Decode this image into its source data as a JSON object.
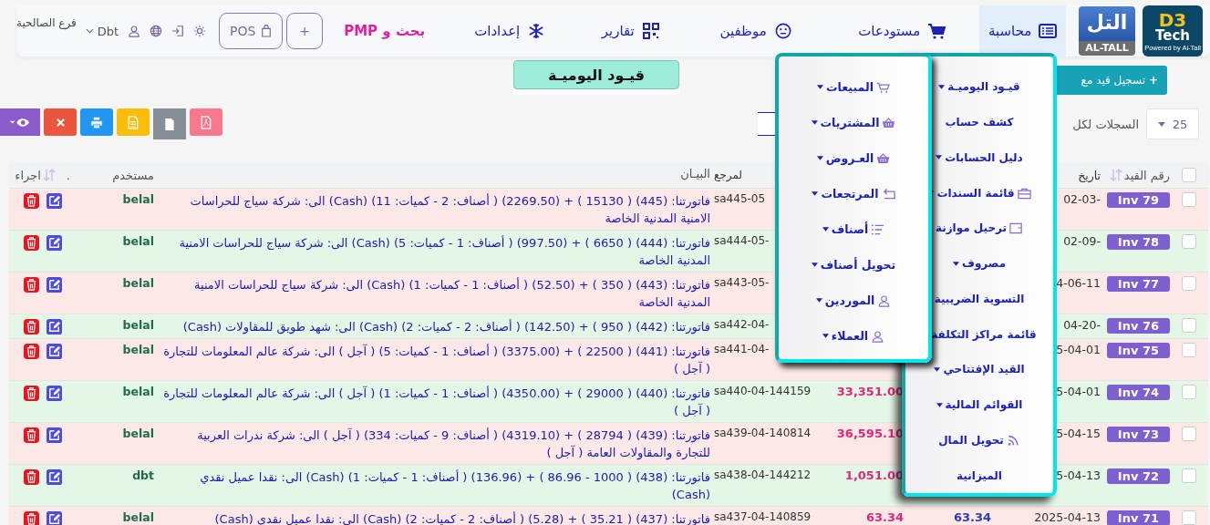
{
  "brand": {
    "logo_main": "D3",
    "logo_sub": "Tech",
    "powered": "Powered by Al-Tall",
    "partner_main": "التل",
    "partner_sub": "AL-TALL"
  },
  "nav": [
    {
      "label": "محاسبة",
      "kind": "table",
      "selected": true
    },
    {
      "label": "مستودعات",
      "kind": "cart",
      "selected": false
    },
    {
      "label": "موظفين",
      "kind": "smile",
      "selected": false
    },
    {
      "label": "تقارير",
      "kind": "qr",
      "selected": false
    },
    {
      "label": "إعدادات",
      "kind": "snow",
      "selected": false
    }
  ],
  "search_link": "بحث و PMP",
  "add_button": "+",
  "pos_button": "POS",
  "user": "Dbt",
  "branch": "فرع الصالحية",
  "page_title": "قيـود اليوميـة",
  "new_entry_button": {
    "icon": "+",
    "label": "تسجيل قيد مع"
  },
  "page_size": {
    "value": "25",
    "label": "السجلات لكل"
  },
  "table": {
    "header": {
      "checked": false,
      "id": "رقم القيد",
      "date": "تاريخ",
      "ref": "لمرجع",
      "desc": "البيـان",
      "user": "مستخدم",
      "dot": ".",
      "actions": "اجراء"
    },
    "rows": [
      {
        "checked": false,
        "id": "Inv 79",
        "date": "-02-03",
        "ref": "sa445-05",
        "desc": "فاتورتنا: (445) ( 15130 ) + (2269.50) ( أصناف: 2 - كميات: 11) (Cash) الى: شركة سياج للحراسات الامنية المدنية الخاصة",
        "user": "belal"
      },
      {
        "checked": false,
        "id": "Inv 78",
        "date": "-02-09",
        "ref": "sa444-05-",
        "desc": "فاتورتنا: (444) ( 6650 ) + (997.50) ( أصناف: 1 - كميات: 5) (Cash) الى: شركة سياج للحراسات الامنية المدنية الخاصة",
        "user": "belal"
      },
      {
        "checked": false,
        "id": "Inv 77",
        "date": "4-06-11",
        "ref": "sa443-05-",
        "desc": "فاتورتنا: (443) ( 350 ) + (52.50) ( أصناف: 1 - كميات: 1) (Cash) الى: شركة سياج للحراسات الامنية المدنية الخاصة",
        "user": "belal"
      },
      {
        "checked": false,
        "id": "Inv 76",
        "date": "-04-20",
        "ref": "sa442-04-",
        "desc": "فاتورتنا: (442) ( 950 ) + (142.50) ( أصناف: 2 - كميات: 2) (Cash) الى: شهد طويق للمقاولات (Cash)",
        "user": "belal"
      },
      {
        "checked": false,
        "id": "Inv 75",
        "date": "5-04-01",
        "ref": "sa441-04-",
        "desc": "فاتورتنا: (441) ( 22500 ) + (3375.00) ( أصناف: 1 - كميات: 5) ( آجل ) الى: شركة عالم المعلومات للتجارة ( آجل )",
        "user": "belal"
      },
      {
        "checked": false,
        "id": "Inv 74",
        "date": "5-04-01",
        "debit": "33,351.00",
        "ref": "sa440-04-144159",
        "desc": "فاتورتنا: (440) ( 29000 ) + (4350.00) ( أصناف: 1 - كميات: 1) ( آجل ) الى: شركة عالم المعلومات للتجارة ( آجل )",
        "user": "belal"
      },
      {
        "checked": false,
        "id": "Inv 73",
        "date": "5-04-15",
        "debit": "36,595.10",
        "ref": "sa439-04-140814",
        "desc": "فاتورتنا: (439) ( 28794 ) + (4319.10) ( أصناف: 9 - كميات: 334) ( آجل ) الى: شركة ندرات العربية للتجارة والمقاولات العامة ( آجل )",
        "user": "belal"
      },
      {
        "checked": false,
        "id": "Inv 72",
        "date": "5-04-13",
        "debit": "1,051.00",
        "ref": "sa438-04-144212",
        "desc": "فاتورتنا: (438) ( 1000 - 86.96 ) + (136.96) ( أصناف: 1 - كميات: 1) (Cash) الى: نقدا عميل نقدي (Cash)",
        "user": "dbt"
      },
      {
        "checked": false,
        "id": "Inv 71",
        "date": "2025-04-13",
        "credit": "63.34",
        "debit": "63.34",
        "ref": "sa437-04-140859",
        "desc": "فاتورتنا: (437) ( 35.21 ) + (5.28) ( أصناف: 2 - كميات: 2) (Cash) الى: نقدا عميل نقدي (Cash)",
        "user": "belal"
      }
    ]
  },
  "menus": [
    {
      "items": [
        {
          "label": "قيـود اليوميـة",
          "kind": "plain",
          "submenu": true
        },
        {
          "label": "كشف حساب",
          "kind": "plain",
          "submenu": false
        },
        {
          "label": "دليل الحسابات",
          "kind": "plain",
          "submenu": true
        },
        {
          "label": "قائمة السندات",
          "kind": "briefcase",
          "submenu": true
        },
        {
          "label": "ترحيل موازنة",
          "kind": "wallet",
          "submenu": false
        },
        {
          "label": "مصروف",
          "kind": "plain",
          "submenu": true
        },
        {
          "label": "التسوية الضريبية",
          "kind": "plain",
          "submenu": false
        },
        {
          "label": "قائمة مراكز التكلفة",
          "kind": "plain",
          "submenu": true
        },
        {
          "label": "القيد الإفتتاحي",
          "kind": "plain",
          "submenu": true
        },
        {
          "label": "القوائم المالية",
          "kind": "plain",
          "submenu": true
        },
        {
          "label": "تحويل المال",
          "kind": "feed",
          "submenu": false
        },
        {
          "label": "الميزانية",
          "kind": "plain",
          "submenu": false
        }
      ]
    },
    {
      "items": [
        {
          "label": "المبيعات",
          "kind": "cart",
          "submenu": true
        },
        {
          "label": "المشتريات",
          "kind": "basket",
          "submenu": true
        },
        {
          "label": "العـروض",
          "kind": "basket",
          "submenu": true
        },
        {
          "label": "المرتجعات",
          "kind": "undo",
          "submenu": true
        },
        {
          "label": "أصناف",
          "kind": "list",
          "submenu": true
        },
        {
          "label": "تحويل أصناف",
          "kind": "plain",
          "submenu": true
        },
        {
          "label": "الموردين",
          "kind": "user",
          "submenu": true
        },
        {
          "label": "العملاء",
          "kind": "user",
          "submenu": true
        }
      ]
    }
  ]
}
